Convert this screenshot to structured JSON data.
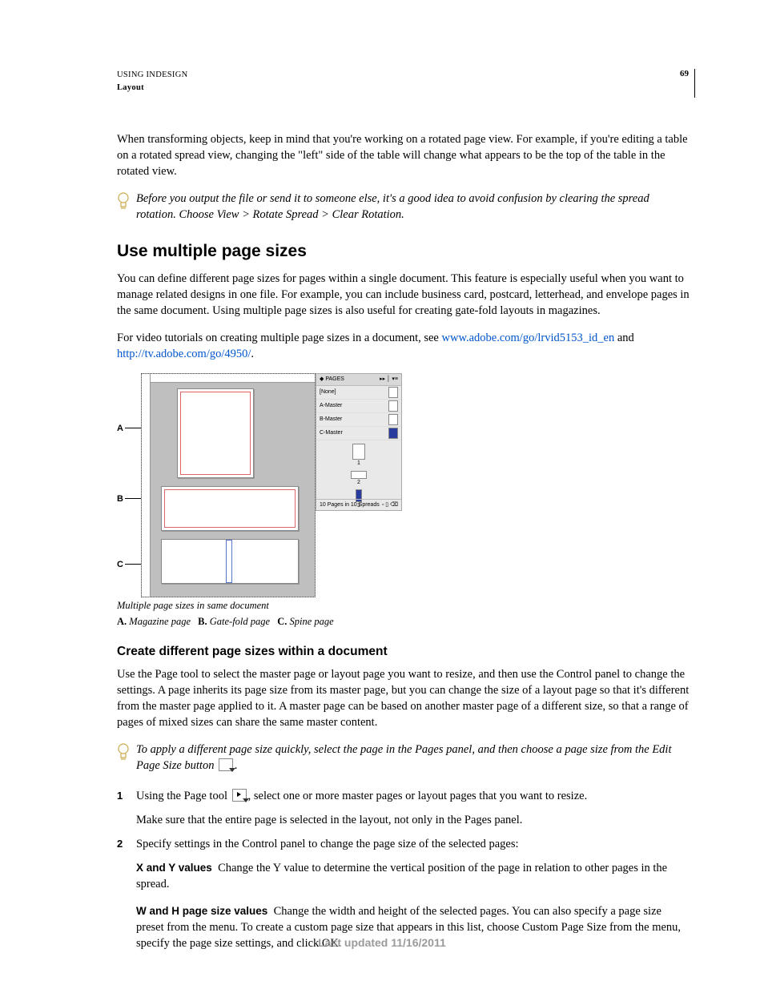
{
  "header": {
    "using": "USING INDESIGN",
    "section": "Layout",
    "page_number": "69"
  },
  "body": {
    "intro_para": "When transforming objects, keep in mind that you're working on a rotated page view. For example, if you're editing a table on a rotated spread view, changing the \"left\" side of the table will change what appears to be the top of the table in the rotated view.",
    "tip1": "Before you output the file or send it to someone else, it's a good idea to avoid confusion by clearing the spread rotation. Choose View > Rotate Spread > Clear Rotation."
  },
  "section1": {
    "title": "Use multiple page sizes",
    "para1": "You can define different page sizes for pages within a single document. This feature is especially useful when you want to manage related designs in one file. For example, you can include business card, postcard, letterhead, and envelope pages in the same document. Using multiple page sizes is also useful for creating gate-fold layouts in magazines.",
    "para2_a": "For video tutorials on creating multiple page sizes in a document, see ",
    "link1": "www.adobe.com/go/lrvid5153_id_en",
    "para2_b": " and ",
    "link2": "http://tv.adobe.com/go/4950/",
    "para2_c": "."
  },
  "figure": {
    "labelA": "A",
    "labelB": "B",
    "labelC": "C",
    "panel_title": "PAGES",
    "panel_none": "[None]",
    "panel_a": "A-Master",
    "panel_b": "B-Master",
    "panel_c": "C-Master",
    "panel_p1": "1",
    "panel_p2": "2",
    "panel_p3": "3",
    "panel_foot": "10 Pages in 10 Spreads",
    "caption": "Multiple page sizes in same document",
    "legend_a_lbl": "A.",
    "legend_a": "Magazine page",
    "legend_b_lbl": "B.",
    "legend_b": "Gate-fold page",
    "legend_c_lbl": "C.",
    "legend_c": "Spine page"
  },
  "section2": {
    "title": "Create different page sizes within a document",
    "para1": "Use the Page tool to select the master page or layout page you want to resize, and then use the Control panel to change the settings. A page inherits its page size from its master page, but you can change the size of a layout page so that it's different from the master page applied to it. A master page can be based on another master page of a different size, so that a range of pages of mixed sizes can share the same master content.",
    "tip2_a": "To apply a different page size quickly, select the page in the Pages panel, and then choose a page size from the Edit Page Size button ",
    "tip2_b": "."
  },
  "steps": {
    "n1": "1",
    "s1a": "Using the Page tool ",
    "s1b": ", select one or more master pages or layout pages that you want to resize.",
    "s1c": "Make sure that the entire page is selected in the layout, not only in the Pages panel.",
    "n2": "2",
    "s2": "Specify settings in the Control panel to change the page size of the selected pages:",
    "xy_label": "X and Y values",
    "xy_text": "Change the Y value to determine the vertical position of the page in relation to other pages in the spread.",
    "wh_label": "W and H page size values",
    "wh_text": "Change the width and height of the selected pages. You can also specify a page size preset from the menu. To create a custom page size that appears in this list, choose Custom Page Size from the menu, specify the page size settings, and click OK."
  },
  "footer": "Last updated 11/16/2011"
}
